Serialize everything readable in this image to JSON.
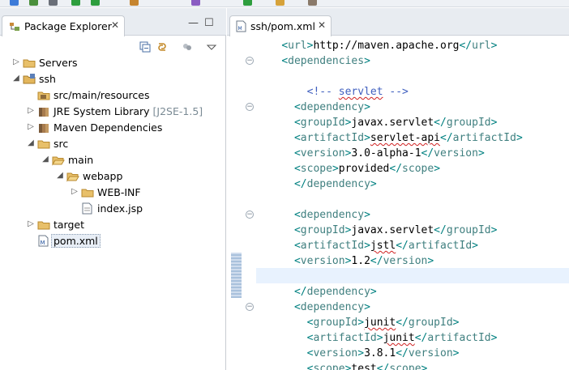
{
  "colors": {
    "bracket": "#008080",
    "tag": "#3f7f7f",
    "text": "#000000",
    "comment": "#3f5fbf",
    "current_line": "#e8f2fe",
    "tab_bar": "#e8ecf1"
  },
  "toolbar": {
    "icons": [
      "new-icon",
      "save-icon",
      "print-icon",
      "debug-icon",
      "run-icon",
      "external-tools-icon",
      "new-package-icon",
      "new-class-icon",
      "open-type-icon",
      "search-icon"
    ]
  },
  "explorer": {
    "tab_label": "Package Explorer",
    "tab_close": "✕",
    "minimize": "—",
    "maximize": "☐",
    "view_icons": [
      "collapse-all-icon",
      "link-with-editor-icon",
      "focus-icon",
      "view-menu-icon"
    ],
    "tree": [
      {
        "label": "Servers",
        "decoration": "",
        "twisty": "▷",
        "icon": "folder-icon"
      },
      {
        "label": "ssh",
        "decoration": "",
        "twisty": "◢",
        "icon": "project-icon"
      },
      {
        "label": "src/main/resources",
        "decoration": "",
        "twisty": "",
        "icon": "source-folder-icon"
      },
      {
        "label": "JRE System Library",
        "decoration": "[J2SE-1.5]",
        "twisty": "▷",
        "icon": "library-icon"
      },
      {
        "label": "Maven Dependencies",
        "decoration": "",
        "twisty": "▷",
        "icon": "library-icon"
      },
      {
        "label": "src",
        "decoration": "",
        "twisty": "◢",
        "icon": "folder-icon"
      },
      {
        "label": "main",
        "decoration": "",
        "twisty": "◢",
        "icon": "folder-open-icon"
      },
      {
        "label": "webapp",
        "decoration": "",
        "twisty": "◢",
        "icon": "folder-open-icon"
      },
      {
        "label": "WEB-INF",
        "decoration": "",
        "twisty": "▷",
        "icon": "folder-icon"
      },
      {
        "label": "index.jsp",
        "decoration": "",
        "twisty": "",
        "icon": "jsp-file-icon"
      },
      {
        "label": "target",
        "decoration": "",
        "twisty": "▷",
        "icon": "folder-icon"
      },
      {
        "label": "pom.xml",
        "decoration": "",
        "twisty": "",
        "icon": "xml-file-icon"
      }
    ]
  },
  "editor": {
    "tab_label": "ssh/pom.xml",
    "tab_close": "✕",
    "fold_marker": "−",
    "lines": [
      "    <url>http://maven.apache.org</url>",
      "    <dependencies>",
      "",
      "        <!-- servlet -->",
      "      <dependency>",
      "      <groupId>javax.servlet</groupId>",
      "      <artifactId>servlet-api</artifactId>",
      "      <version>3.0-alpha-1</version>",
      "      <scope>provided</scope>",
      "      </dependency>",
      "",
      "      <dependency>",
      "      <groupId>javax.servlet</groupId>",
      "      <artifactId>jstl</artifactId>",
      "      <version>1.2</version>",
      "",
      "      </dependency>",
      "      <dependency>",
      "        <groupId>junit</groupId>",
      "        <artifactId>junit</artifactId>",
      "        <version>3.8.1</version>",
      "        <scope>test</scope>"
    ]
  }
}
